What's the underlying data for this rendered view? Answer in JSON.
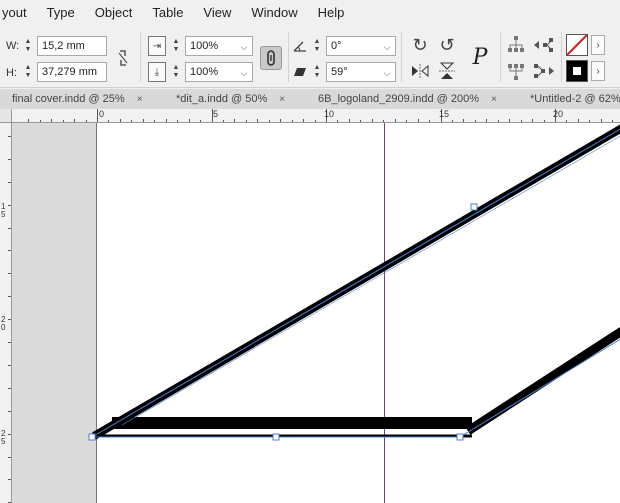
{
  "menu": [
    "yout",
    "Type",
    "Object",
    "Table",
    "View",
    "Window",
    "Help"
  ],
  "control": {
    "w_label": "W:",
    "h_label": "H:",
    "width_value": "15,2 mm",
    "height_value": "37,279 mm",
    "scale_x_value": "100%",
    "scale_y_value": "100%",
    "rotation_value": "0°",
    "shear_value": "59°",
    "type_on_path_glyph": "P"
  },
  "tabs": [
    {
      "label": "final cover.indd @ 25%"
    },
    {
      "label": "*dit_a.indd @ 50%"
    },
    {
      "label": "6B_logoland_2909.indd @ 200%"
    },
    {
      "label": "*Untitled-2 @ 62%"
    }
  ],
  "tab_close_glyph": "×",
  "ruler": {
    "h_labels": [
      "0",
      "5",
      "10",
      "15",
      "20"
    ],
    "v_labels": [
      "1\n5",
      "2\n0",
      "2\n5"
    ]
  },
  "colors": {
    "guide": "#7a3a9a",
    "selection": "#4a7fd0",
    "stroke": "#000000"
  }
}
